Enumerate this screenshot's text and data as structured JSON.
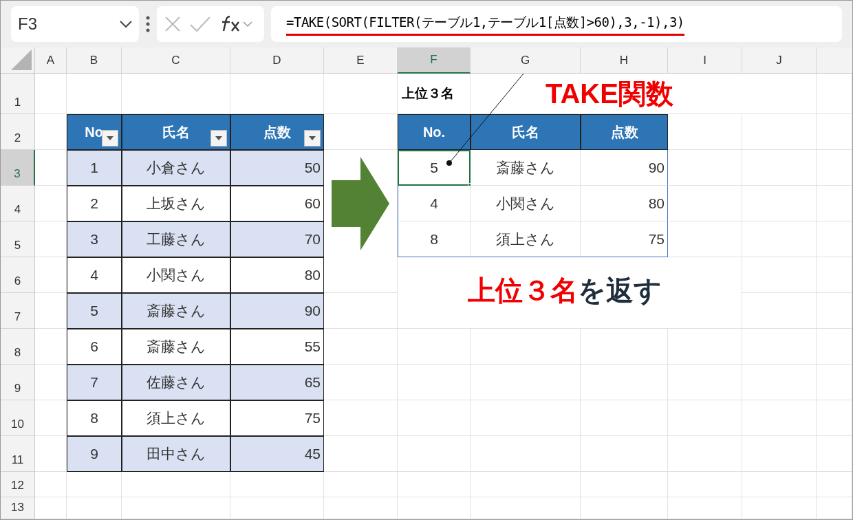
{
  "name_box": "F3",
  "formula": "=TAKE(SORT(FILTER(テーブル1,テーブル1[点数]>60),3,-1),3)",
  "column_headers": [
    {
      "label": "A",
      "selected": false
    },
    {
      "label": "B",
      "selected": false
    },
    {
      "label": "C",
      "selected": false
    },
    {
      "label": "D",
      "selected": false
    },
    {
      "label": "E",
      "selected": false
    },
    {
      "label": "F",
      "selected": true
    },
    {
      "label": "G",
      "selected": false
    },
    {
      "label": "H",
      "selected": false
    },
    {
      "label": "I",
      "selected": false
    },
    {
      "label": "J",
      "selected": false
    }
  ],
  "row_headers": [
    {
      "label": "1",
      "selected": false
    },
    {
      "label": "2",
      "selected": false
    },
    {
      "label": "3",
      "selected": true
    },
    {
      "label": "4",
      "selected": false
    },
    {
      "label": "5",
      "selected": false
    },
    {
      "label": "6",
      "selected": false
    },
    {
      "label": "7",
      "selected": false
    },
    {
      "label": "8",
      "selected": false
    },
    {
      "label": "9",
      "selected": false
    },
    {
      "label": "10",
      "selected": false
    },
    {
      "label": "11",
      "selected": false
    },
    {
      "label": "12",
      "selected": false
    },
    {
      "label": "13",
      "selected": false
    }
  ],
  "source_table": {
    "columns": [
      "No",
      "氏名",
      "点数"
    ],
    "rows": [
      [
        "1",
        "小倉さん",
        "50"
      ],
      [
        "2",
        "上坂さん",
        "60"
      ],
      [
        "3",
        "工藤さん",
        "70"
      ],
      [
        "4",
        "小関さん",
        "80"
      ],
      [
        "5",
        "斎藤さん",
        "90"
      ],
      [
        "6",
        "斎藤さん",
        "55"
      ],
      [
        "7",
        "佐藤さん",
        "65"
      ],
      [
        "8",
        "須上さん",
        "75"
      ],
      [
        "9",
        "田中さん",
        "45"
      ]
    ]
  },
  "result_title": "上位３名",
  "result_table": {
    "columns": [
      "No.",
      "氏名",
      "点数"
    ],
    "rows": [
      {
        "cells": [
          "5",
          "斎藤さん",
          "90"
        ],
        "selected": true
      },
      {
        "cells": [
          "4",
          "小関さん",
          "80"
        ],
        "selected": false
      },
      {
        "cells": [
          "8",
          "須上さん",
          "75"
        ],
        "selected": false
      }
    ]
  },
  "callout": "TAKE関数",
  "caption": {
    "highlight": "上位３名",
    "rest": "を返す"
  }
}
